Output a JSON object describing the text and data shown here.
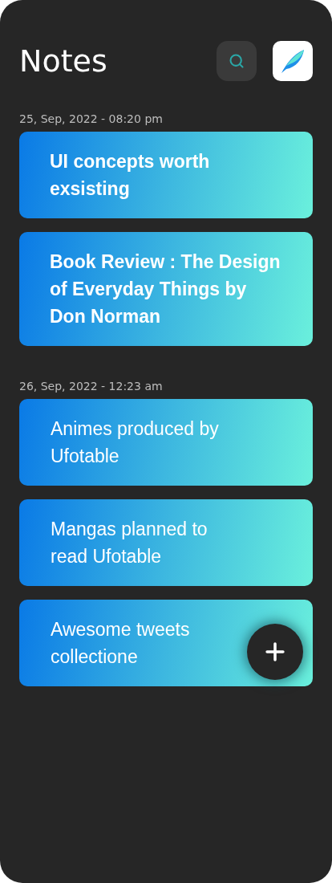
{
  "title": "Notes",
  "groups": [
    {
      "date": "25, Sep, 2022 - 08:20 pm",
      "notes": [
        {
          "title": "UI concepts worth exsisting",
          "kind": "bold"
        },
        {
          "title": "Book Review : The Design of Everyday Things by Don Norman",
          "kind": "bold"
        }
      ]
    },
    {
      "date": "26, Sep, 2022 - 12:23 am",
      "notes": [
        {
          "title": "Animes produced by Ufotable",
          "kind": "regular"
        },
        {
          "title": "Mangas planned to read Ufotable",
          "kind": "regular"
        },
        {
          "title": "Awesome tweets collectione",
          "kind": "regular"
        }
      ]
    }
  ]
}
